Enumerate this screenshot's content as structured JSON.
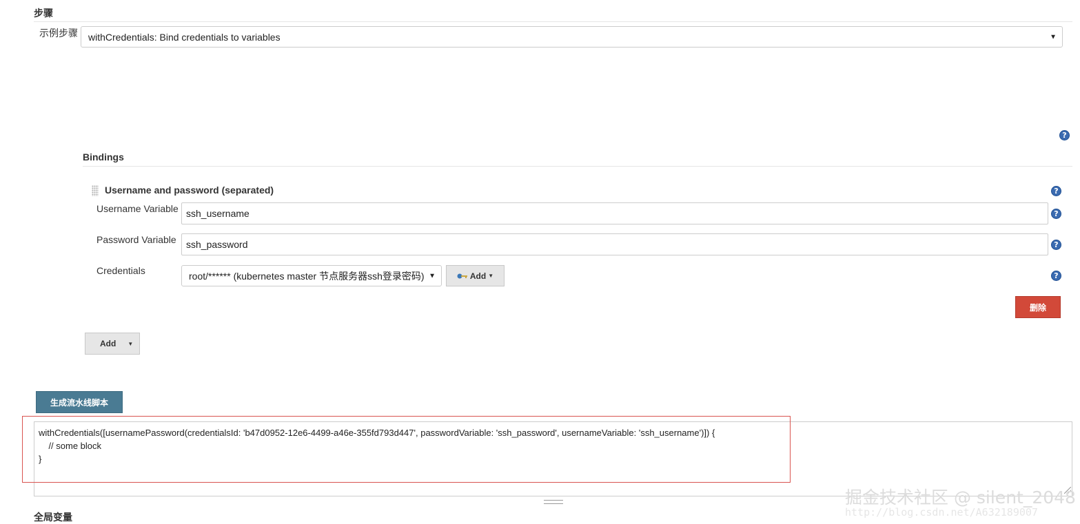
{
  "steps": {
    "title": "步骤",
    "sample_label": "示例步骤",
    "sample_value": "withCredentials: Bind credentials to variables",
    "caret": "▼"
  },
  "bindings": {
    "title": "Bindings",
    "binding_title": "Username and password (separated)",
    "username_label": "Username Variable",
    "username_value": "ssh_username",
    "password_label": "Password Variable",
    "password_value": "ssh_password",
    "credentials_label": "Credentials",
    "credentials_value": "root/****** (kubernetes master 节点服务器ssh登录密码)",
    "add_key_label": "Add",
    "delete_label": "删除",
    "add_binding_label": "Add"
  },
  "generate_button": "生成流水线脚本",
  "script": {
    "line1": "withCredentials([usernamePassword(credentialsId: 'b47d0952-12e6-4499-a46e-355fd793d447', passwordVariable: 'ssh_password', usernameVariable: 'ssh_username')]) {",
    "line2": "    // some block",
    "line3": "}"
  },
  "global_vars_title": "全局变量",
  "help_glyph": "?",
  "watermark": {
    "main": "掘金技术社区 @ silent_2048",
    "url": "http://blog.csdn.net/A632189007"
  },
  "colors": {
    "help_icon": "#3b6bb0",
    "delete_button": "#d24939",
    "generate_button": "#4a7b93",
    "highlight_frame": "#d9534f"
  }
}
